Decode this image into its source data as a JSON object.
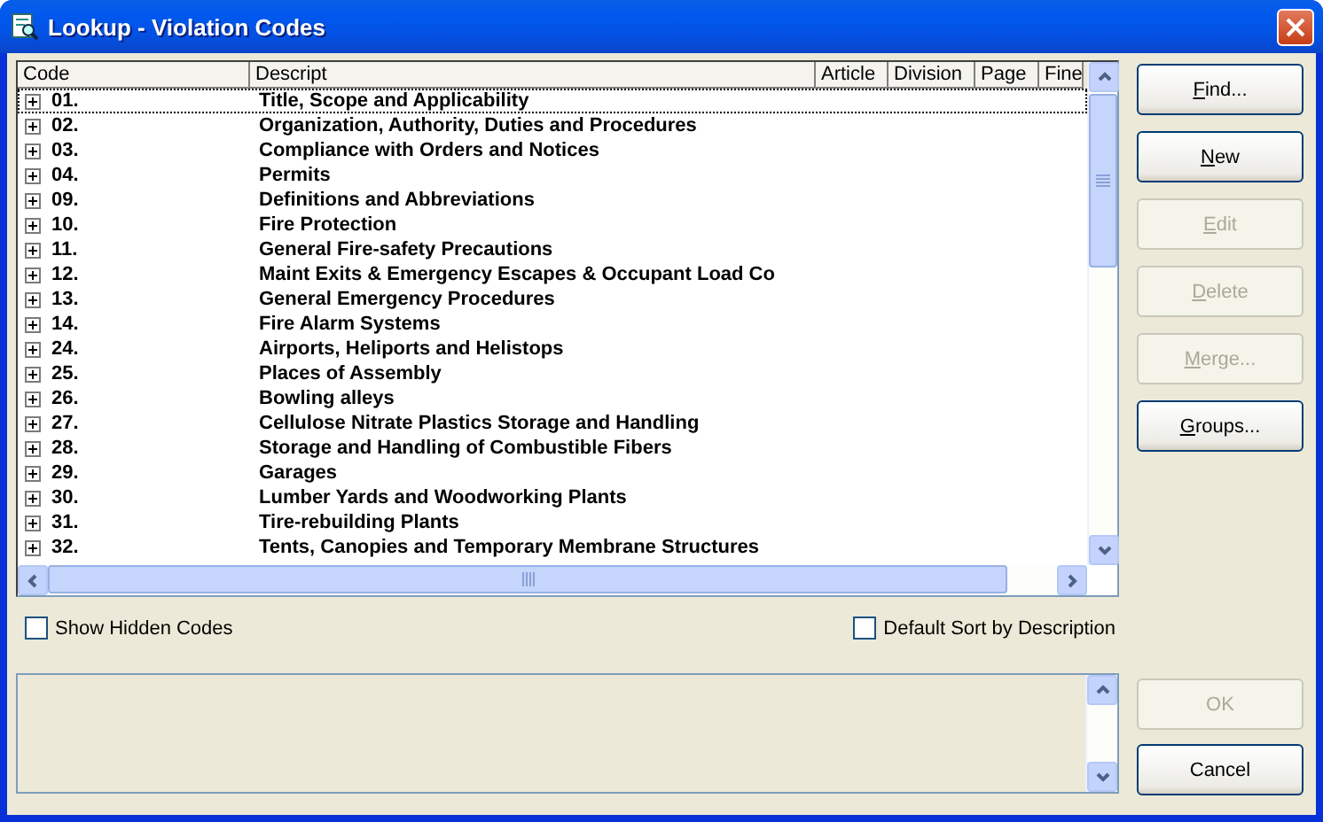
{
  "window": {
    "title": "Lookup - Violation Codes"
  },
  "table": {
    "columns": [
      "Code",
      "Descript",
      "Article",
      "Division",
      "Page",
      "Fine"
    ],
    "rows": [
      {
        "code": "01.",
        "description": "Title, Scope and Applicability",
        "focused": true
      },
      {
        "code": "02.",
        "description": "Organization, Authority, Duties and Procedures",
        "focused": false
      },
      {
        "code": "03.",
        "description": "Compliance with Orders and Notices",
        "focused": false
      },
      {
        "code": "04.",
        "description": "Permits",
        "focused": false
      },
      {
        "code": "09.",
        "description": "Definitions and Abbreviations",
        "focused": false
      },
      {
        "code": "10.",
        "description": "Fire Protection",
        "focused": false
      },
      {
        "code": "11.",
        "description": "General Fire-safety Precautions",
        "focused": false
      },
      {
        "code": "12.",
        "description": "Maint Exits & Emergency Escapes & Occupant Load Co",
        "focused": false
      },
      {
        "code": "13.",
        "description": "General Emergency Procedures",
        "focused": false
      },
      {
        "code": "14.",
        "description": "Fire Alarm Systems",
        "focused": false
      },
      {
        "code": "24.",
        "description": "Airports, Heliports and Helistops",
        "focused": false
      },
      {
        "code": "25.",
        "description": "Places of Assembly",
        "focused": false
      },
      {
        "code": "26.",
        "description": "Bowling alleys",
        "focused": false
      },
      {
        "code": "27.",
        "description": "Cellulose Nitrate Plastics Storage and Handling",
        "focused": false
      },
      {
        "code": "28.",
        "description": "Storage and Handling of Combustible Fibers",
        "focused": false
      },
      {
        "code": "29.",
        "description": "Garages",
        "focused": false
      },
      {
        "code": "30.",
        "description": "Lumber Yards and Woodworking Plants",
        "focused": false
      },
      {
        "code": "31.",
        "description": "Tire-rebuilding Plants",
        "focused": false
      },
      {
        "code": "32.",
        "description": "Tents, Canopies and Temporary Membrane Structures",
        "focused": false
      }
    ]
  },
  "side_buttons": [
    {
      "label": "Find...",
      "disabled": false,
      "access_key": true
    },
    {
      "label": "New",
      "disabled": false,
      "access_key": true
    },
    {
      "label": "Edit",
      "disabled": true,
      "access_key": true
    },
    {
      "label": "Delete",
      "disabled": true,
      "access_key": true
    },
    {
      "label": "Merge...",
      "disabled": true,
      "access_key": true
    },
    {
      "label": "Groups...",
      "disabled": false,
      "access_key": true
    }
  ],
  "checkboxes": [
    {
      "label": "Show Hidden Codes",
      "checked": false
    },
    {
      "label": "Default Sort by Description",
      "checked": false
    }
  ],
  "bottom_buttons": [
    {
      "label": "OK",
      "disabled": true,
      "access_key": false
    },
    {
      "label": "Cancel",
      "disabled": false,
      "access_key": false
    }
  ]
}
